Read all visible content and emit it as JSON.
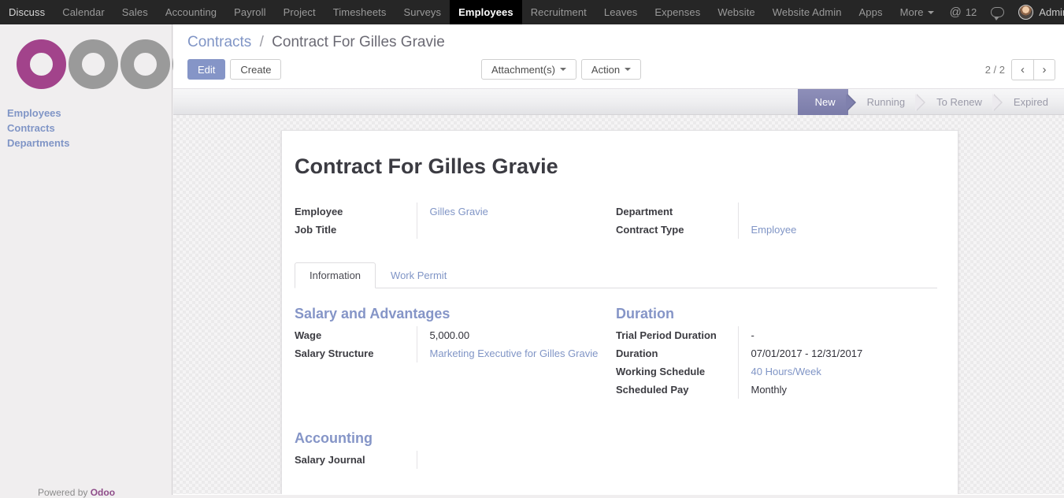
{
  "topbar": {
    "menu_items": [
      {
        "label": "Discuss",
        "active": false
      },
      {
        "label": "Calendar",
        "active": false
      },
      {
        "label": "Sales",
        "active": false
      },
      {
        "label": "Accounting",
        "active": false
      },
      {
        "label": "Payroll",
        "active": false
      },
      {
        "label": "Project",
        "active": false
      },
      {
        "label": "Timesheets",
        "active": false
      },
      {
        "label": "Surveys",
        "active": false
      },
      {
        "label": "Employees",
        "active": true
      },
      {
        "label": "Recruitment",
        "active": false
      },
      {
        "label": "Leaves",
        "active": false
      },
      {
        "label": "Expenses",
        "active": false
      },
      {
        "label": "Website",
        "active": false
      },
      {
        "label": "Website Admin",
        "active": false
      },
      {
        "label": "Apps",
        "active": false
      },
      {
        "label": "More",
        "active": false,
        "has_caret": true
      }
    ],
    "mention_count": "12",
    "user_name": "Administrator"
  },
  "sidebar": {
    "logo_text": "odoo",
    "links": [
      {
        "label": "Employees"
      },
      {
        "label": "Contracts"
      },
      {
        "label": "Departments"
      }
    ],
    "powered_by": "Powered by Odoo"
  },
  "control_panel": {
    "breadcrumb_root": "Contracts",
    "breadcrumb_separator": "/",
    "breadcrumb_current": "Contract For Gilles Gravie",
    "edit_label": "Edit",
    "create_label": "Create",
    "attachments_label": "Attachment(s)",
    "action_label": "Action",
    "pager_text": "2 / 2",
    "pager_prev": "‹",
    "pager_next": "›"
  },
  "statusbar": {
    "stages": [
      {
        "label": "New",
        "active": true
      },
      {
        "label": "Running",
        "active": false
      },
      {
        "label": "To Renew",
        "active": false
      },
      {
        "label": "Expired",
        "active": false
      }
    ]
  },
  "form": {
    "title": "Contract For Gilles Gravie",
    "header_fields_left": [
      {
        "label": "Employee",
        "value": "Gilles Gravie",
        "link": true
      },
      {
        "label": "Job Title",
        "value": "",
        "link": false
      }
    ],
    "header_fields_right": [
      {
        "label": "Department",
        "value": "",
        "link": false
      },
      {
        "label": "Contract Type",
        "value": "Employee",
        "link": true
      }
    ],
    "tabs": [
      {
        "label": "Information",
        "active": true
      },
      {
        "label": "Work Permit",
        "active": false
      }
    ],
    "salary_section": {
      "title": "Salary and Advantages",
      "fields": [
        {
          "label": "Wage",
          "value": "5,000.00",
          "link": false
        },
        {
          "label": "Salary Structure",
          "value": "Marketing Executive for Gilles Gravie",
          "link": true
        }
      ]
    },
    "duration_section": {
      "title": "Duration",
      "fields": [
        {
          "label": "Trial Period Duration",
          "value": "-",
          "link": false
        },
        {
          "label": "Duration",
          "value": "07/01/2017 - 12/31/2017",
          "link": false
        },
        {
          "label": "Working Schedule",
          "value": "40 Hours/Week",
          "link": true
        },
        {
          "label": "Scheduled Pay",
          "value": "Monthly",
          "link": false
        }
      ]
    },
    "accounting_section": {
      "title": "Accounting",
      "fields": [
        {
          "label": "Salary Journal",
          "value": "",
          "link": false
        }
      ]
    }
  },
  "colors": {
    "accent": "#8595c7",
    "link": "#8095c6",
    "topbar_bg": "#262626",
    "brand_magenta": "#a2438b"
  }
}
